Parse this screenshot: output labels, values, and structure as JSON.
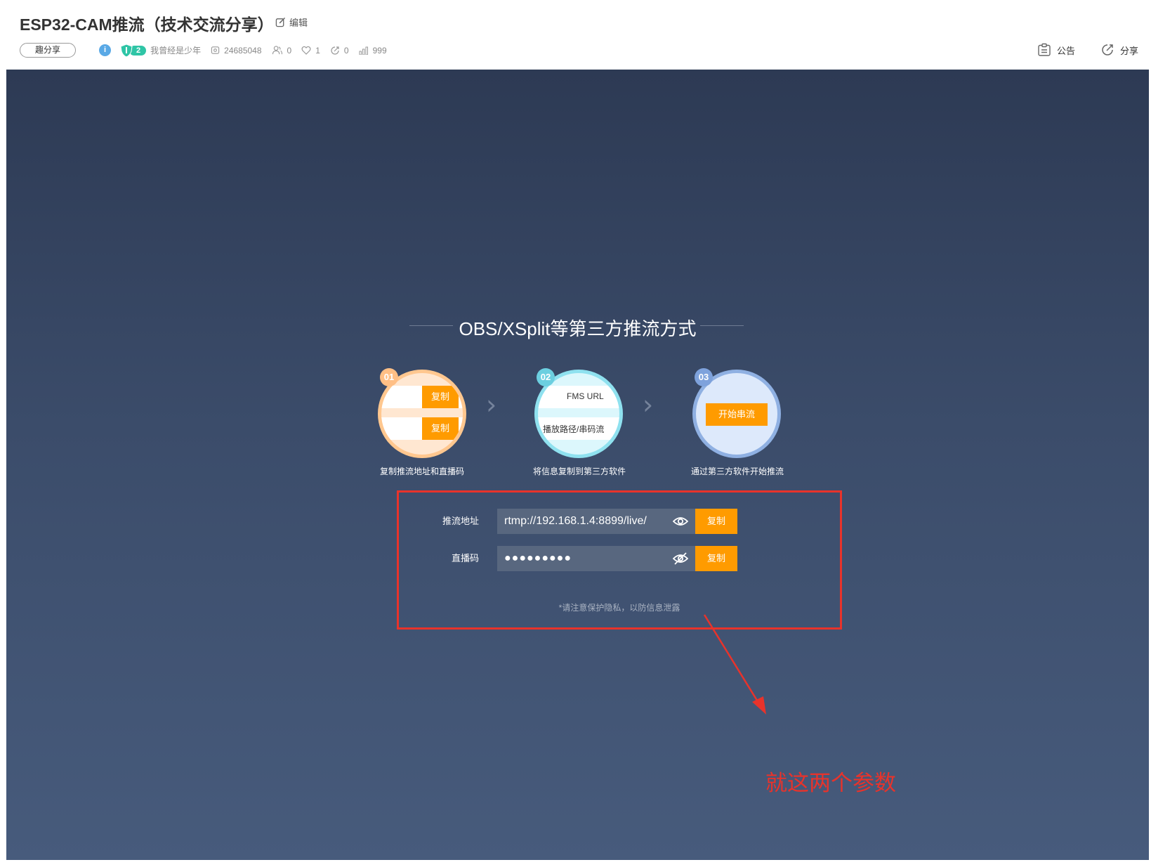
{
  "header": {
    "title": "ESP32-CAM推流（技术交流分享）",
    "edit_label": "编辑",
    "category": "趣分享",
    "level": "2",
    "author": "我曾经是少年",
    "room_id": "24685048",
    "followers": "0",
    "likes": "1",
    "shares": "0",
    "popularity": "999",
    "announcement_label": "公告",
    "share_label": "分享"
  },
  "stage": {
    "section_title": "OBS/XSplit等第三方推流方式",
    "steps": [
      {
        "num": "01",
        "caption": "复制推流地址和直播码",
        "copy_label_1": "复制",
        "copy_label_2": "复制"
      },
      {
        "num": "02",
        "caption": "将信息复制到第三方软件",
        "field_1": "FMS URL",
        "field_2": "播放路径/串码流"
      },
      {
        "num": "03",
        "caption": "通过第三方软件开始推流",
        "button_label": "开始串流"
      }
    ],
    "form": {
      "push_url_label": "推流地址",
      "push_url_value": "rtmp://192.168.1.4:8899/live/",
      "stream_key_label": "直播码",
      "stream_key_value": "●●●●●●●●●",
      "copy_label": "复制",
      "privacy_note": "*请注意保护隐私，以防信息泄露"
    },
    "annotation": "就这两个参数"
  },
  "colors": {
    "accent_orange": "#ff9b00",
    "annotation_red": "#e8332b",
    "level_green": "#2fc5a6"
  }
}
